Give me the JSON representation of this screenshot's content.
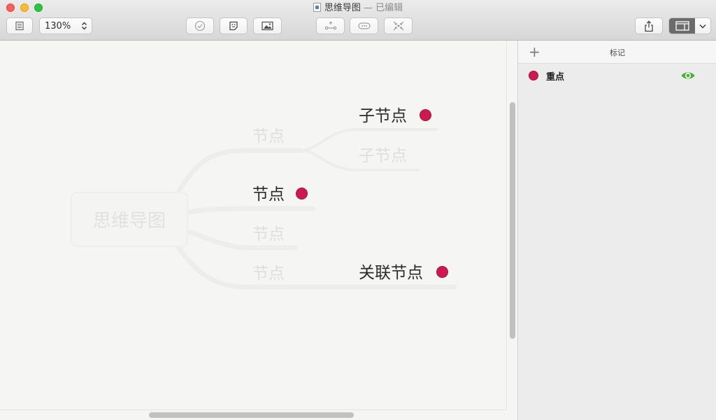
{
  "window": {
    "title": "思维导图",
    "status": "— 已编辑"
  },
  "toolbar": {
    "zoom_value": "130%",
    "zoom_stepper_icon": "chevron-up-down-icon",
    "buttons": [
      {
        "name": "sidebar-toggle",
        "icon": "outline-icon"
      },
      {
        "name": "task",
        "icon": "checkmark-circle-icon"
      },
      {
        "name": "sticker",
        "icon": "sticker-icon"
      },
      {
        "name": "image",
        "icon": "image-icon"
      },
      {
        "name": "add-child",
        "icon": "add-child-node-icon"
      },
      {
        "name": "add-sibling",
        "icon": "summary-icon"
      },
      {
        "name": "collapse",
        "icon": "focus-icon"
      },
      {
        "name": "share",
        "icon": "share-icon"
      },
      {
        "name": "view",
        "icon": "sidebar-panel-icon"
      }
    ]
  },
  "mindmap": {
    "root": "思维导图",
    "nodes": [
      {
        "label": "节点",
        "style": "faint"
      },
      {
        "label": "子节点",
        "style": "strong",
        "marked": true
      },
      {
        "label": "子节点",
        "style": "faint"
      },
      {
        "label": "节点",
        "style": "strong",
        "marked": true
      },
      {
        "label": "节点",
        "style": "faint"
      },
      {
        "label": "节点",
        "style": "faint"
      },
      {
        "label": "关联节点",
        "style": "strong",
        "marked": true
      }
    ],
    "marker_color": "#cc1a50"
  },
  "panel": {
    "title": "标记",
    "add_label": "+",
    "tags": [
      {
        "label": "重点",
        "color": "#cc1a50",
        "visible_icon": "eye-icon",
        "eye_color": "#4caf3a"
      }
    ]
  }
}
